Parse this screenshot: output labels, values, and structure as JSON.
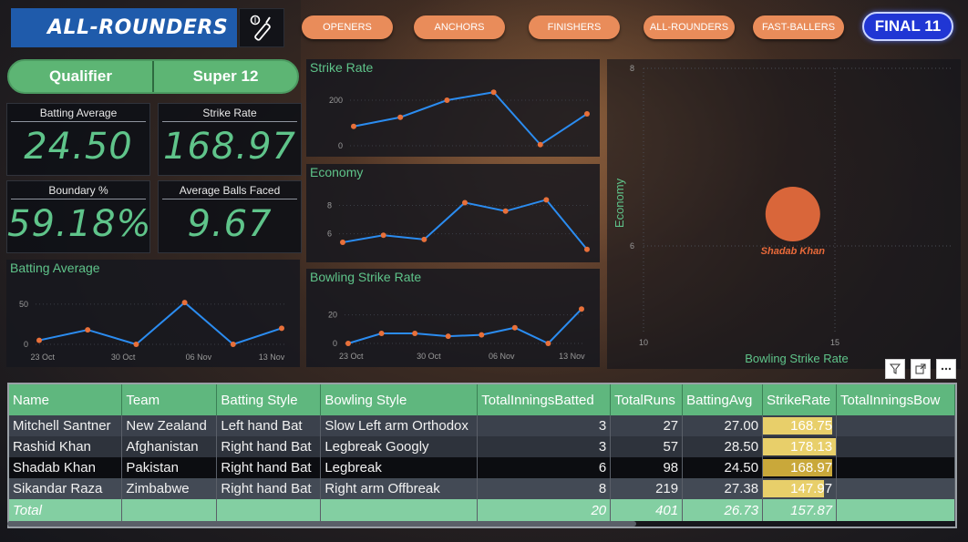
{
  "header": {
    "title": "ALL-ROUNDERS",
    "nav": [
      "OPENERS",
      "ANCHORS",
      "FINISHERS",
      "ALL-ROUNDERS",
      "FAST-BALLERS"
    ],
    "final_label": "FINAL 11"
  },
  "stage_toggle": [
    "Qualifier",
    "Super 12"
  ],
  "kpis": [
    {
      "label": "Batting Average",
      "value": "24.50"
    },
    {
      "label": "Strike Rate",
      "value": "168.97"
    },
    {
      "label": "Boundary %",
      "value": "59.18%"
    },
    {
      "label": "Average Balls Faced",
      "value": "9.67"
    }
  ],
  "charts": {
    "batting_average": {
      "title": "Batting Average"
    },
    "strike_rate": {
      "title": "Strike Rate"
    },
    "economy": {
      "title": "Economy"
    },
    "bowling_strike_rate": {
      "title": "Bowling Strike Rate"
    },
    "scatter": {
      "xlabel": "Bowling Strike Rate",
      "ylabel": "Economy",
      "point_label": "Shadab Khan"
    }
  },
  "chart_data": [
    {
      "type": "line",
      "title": "Batting Average",
      "x": [
        "2021-10-17",
        "2021-10-24",
        "2021-10-31",
        "2021-11-03",
        "2021-11-07",
        "2021-11-14"
      ],
      "values": [
        5,
        18,
        0,
        52,
        0,
        20
      ],
      "ylim": [
        0,
        60
      ],
      "yticks": [
        0,
        50
      ],
      "xticks": [
        "23 Oct",
        "30 Oct",
        "06 Nov",
        "13 Nov"
      ]
    },
    {
      "type": "line",
      "title": "Strike Rate",
      "values": [
        85,
        125,
        200,
        235,
        5,
        140
      ],
      "ylim": [
        0,
        260
      ],
      "yticks": [
        0,
        200
      ]
    },
    {
      "type": "line",
      "title": "Economy",
      "values": [
        5.4,
        5.9,
        5.6,
        8.2,
        7.6,
        8.4,
        4.9
      ],
      "ylim": [
        4.5,
        9
      ],
      "yticks": [
        6,
        8
      ]
    },
    {
      "type": "line",
      "title": "Bowling Strike Rate",
      "x": [
        "2021-10-17",
        "2021-10-21",
        "2021-10-24",
        "2021-10-27",
        "2021-10-31",
        "2021-11-03",
        "2021-11-07",
        "2021-11-10",
        "2021-11-14"
      ],
      "values": [
        0,
        7,
        7,
        5,
        6,
        11,
        0,
        24
      ],
      "ylim": [
        0,
        28
      ],
      "yticks": [
        0,
        20
      ],
      "xticks": [
        "23 Oct",
        "30 Oct",
        "06 Nov",
        "13 Nov"
      ]
    },
    {
      "type": "scatter",
      "xlabel": "Bowling Strike Rate",
      "ylabel": "Economy",
      "xlim": [
        10,
        15
      ],
      "ylim": [
        6,
        8
      ],
      "xticks": [
        10,
        15
      ],
      "yticks": [
        6,
        8
      ],
      "points": [
        {
          "label": "Shadab Khan",
          "x": 13.9,
          "y": 6.7
        }
      ]
    }
  ],
  "table": {
    "columns": [
      "Name",
      "Team",
      "Batting Style",
      "Bowling Style",
      "TotalInningsBatted",
      "TotalRuns",
      "BattingAvg",
      "StrikeRate",
      "TotalInningsBow"
    ],
    "rows": [
      [
        "Mitchell Santner",
        "New Zealand",
        "Left hand Bat",
        "Slow Left arm Orthodox",
        "3",
        "27",
        "27.00",
        "168.75",
        ""
      ],
      [
        "Rashid Khan",
        "Afghanistan",
        "Right hand Bat",
        "Legbreak Googly",
        "3",
        "57",
        "28.50",
        "178.13",
        ""
      ],
      [
        "Shadab Khan",
        "Pakistan",
        "Right hand Bat",
        "Legbreak",
        "6",
        "98",
        "24.50",
        "168.97",
        ""
      ],
      [
        "Sikandar Raza",
        "Zimbabwe",
        "Right hand Bat",
        "Right arm Offbreak",
        "8",
        "219",
        "27.38",
        "147.97",
        ""
      ]
    ],
    "total": [
      "Total",
      "",
      "",
      "",
      "20",
      "401",
      "26.73",
      "157.87",
      ""
    ],
    "strike_rate_max": 178.13,
    "highlight_color": "#e8cf6a",
    "selected_highlight_color": "#c9a83a"
  },
  "colors": {
    "accent_green": "#5fc48a",
    "line_blue": "#2b8cf0",
    "point_orange": "#e8703a",
    "nav_orange": "#e98c5a",
    "final_blue": "#2036d4",
    "logo_blue": "#1f5bab"
  }
}
